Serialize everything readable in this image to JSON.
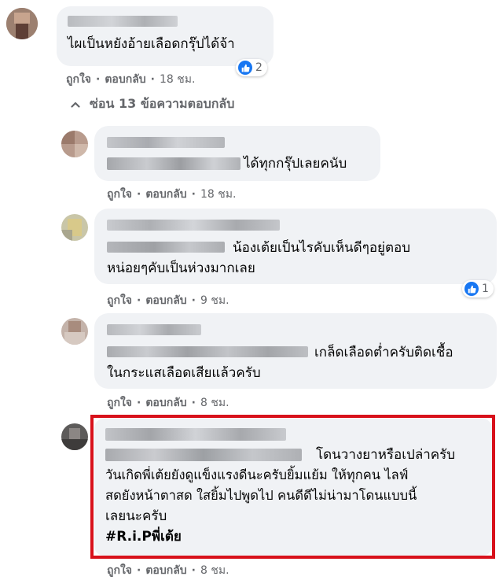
{
  "colors": {
    "bubble": "#f0f2f5",
    "meta_text": "#65676b",
    "like_blue": "#1877f2",
    "highlight_red": "#d8111b"
  },
  "comments": [
    {
      "text_lines": [
        "ไผเป็นหยังอ้ายเลือดกรุ๊ปได้จ้า"
      ],
      "like_label": "ถูกใจ",
      "reply_label": "ตอบกลับ",
      "time": "18 ชม.",
      "reactions": {
        "icon": "like-icon",
        "count": "2"
      }
    }
  ],
  "hide_replies": {
    "icon": "chevron-up-icon",
    "label": "ซ่อน 13 ข้อความตอบกลับ"
  },
  "replies": [
    {
      "text_lines": [
        "ได้ทุกกรุ๊ปเลยคนับ"
      ],
      "like_label": "ถูกใจ",
      "reply_label": "ตอบกลับ",
      "time": "18 ชม."
    },
    {
      "text_lines": [
        "น้องเต้ยเป็นไรคับเห็นดีๆอยู่ตอบ",
        "หน่อยๆคับเป็นห่วงมากเลย"
      ],
      "like_label": "ถูกใจ",
      "reply_label": "ตอบกลับ",
      "time": "9 ชม.",
      "reactions": {
        "icon": "like-icon",
        "count": "1"
      }
    },
    {
      "text_lines": [
        "เกล็ดเลือดต่ำครับติดเชื้อ",
        "ในกระแสเลือดเสียแล้วครับ"
      ],
      "like_label": "ถูกใจ",
      "reply_label": "ตอบกลับ",
      "time": "8 ชม."
    },
    {
      "text_lines": [
        "โดนวางยาหรือเปล่าครับ",
        "วันเกิดพี่เต้ยยังดูแข็งแรงดีนะครับยิ้มแย้ม ให้ทุกคน ไลฟ์",
        "สดยังหน้าตาสด ใสยิ้มไปพูดไป คนดีดีไม่น่ามาโดนแบบนี้",
        "เลยนะครับ",
        "#R.i.Pพี่เต้ย"
      ],
      "like_label": "ถูกใจ",
      "reply_label": "ตอบกลับ",
      "time": "8 ชม.",
      "highlighted": true
    }
  ]
}
